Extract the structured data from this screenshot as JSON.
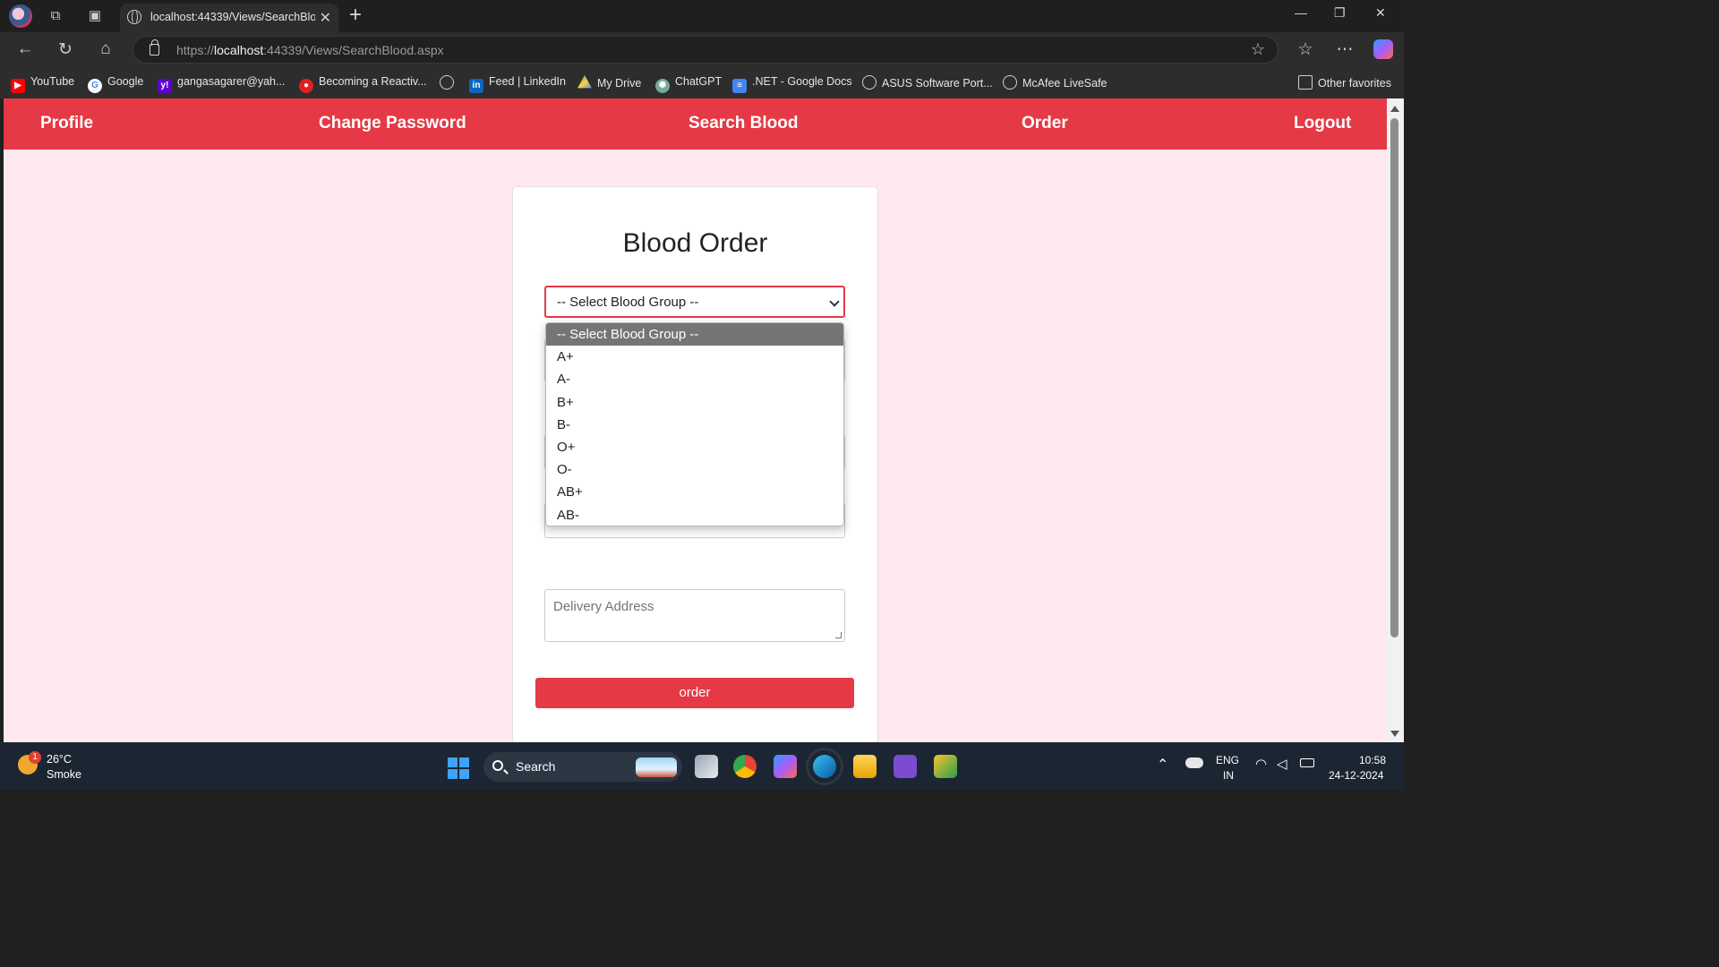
{
  "browser": {
    "tab_title": "localhost:44339/Views/SearchBlood.aspx",
    "url_scheme": "https://",
    "url_host": "localhost",
    "url_rest": ":44339/Views/SearchBlood.aspx",
    "bookmarks": [
      {
        "label": "YouTube",
        "icon": "youtube-icon",
        "color": "#ff0000"
      },
      {
        "label": "Google",
        "icon": "google-icon",
        "color": "#4285f4"
      },
      {
        "label": "gangasagarer@yah...",
        "icon": "yahoo-icon",
        "color": "#6001d2"
      },
      {
        "label": "Becoming a Reactiv...",
        "icon": "record-icon",
        "color": "#e02020"
      },
      {
        "label": "",
        "icon": "globe-icon",
        "color": "#cfcfcf"
      },
      {
        "label": "Feed | LinkedIn",
        "icon": "linkedin-icon",
        "color": "#0a66c2"
      },
      {
        "label": "My Drive",
        "icon": "drive-icon",
        "color": "#1fa463"
      },
      {
        "label": "ChatGPT",
        "icon": "chatgpt-icon",
        "color": "#74aa9c"
      },
      {
        "label": ".NET - Google Docs",
        "icon": "docs-icon",
        "color": "#4285f4"
      },
      {
        "label": "ASUS Software Port...",
        "icon": "globe-icon",
        "color": "#cfcfcf"
      },
      {
        "label": "McAfee LiveSafe",
        "icon": "globe-icon",
        "color": "#cfcfcf"
      }
    ],
    "other_favorites": "Other favorites"
  },
  "nav": {
    "links": [
      "Profile",
      "Change Password",
      "Search Blood",
      "Order",
      "Logout"
    ],
    "color": "#e63946"
  },
  "form": {
    "title": "Blood Order",
    "select_value": "-- Select Blood Group --",
    "options": [
      "-- Select Blood Group --",
      "A+",
      "A-",
      "B+",
      "B-",
      "O+",
      "O-",
      "AB+",
      "AB-"
    ],
    "address_placeholder": "Delivery Address",
    "submit_label": "order"
  },
  "taskbar": {
    "temperature": "26°C",
    "condition": "Smoke",
    "weather_badge": "1",
    "search_label": "Search",
    "language_top": "ENG",
    "language_bottom": "IN",
    "time": "10:58",
    "date": "24-12-2024"
  }
}
